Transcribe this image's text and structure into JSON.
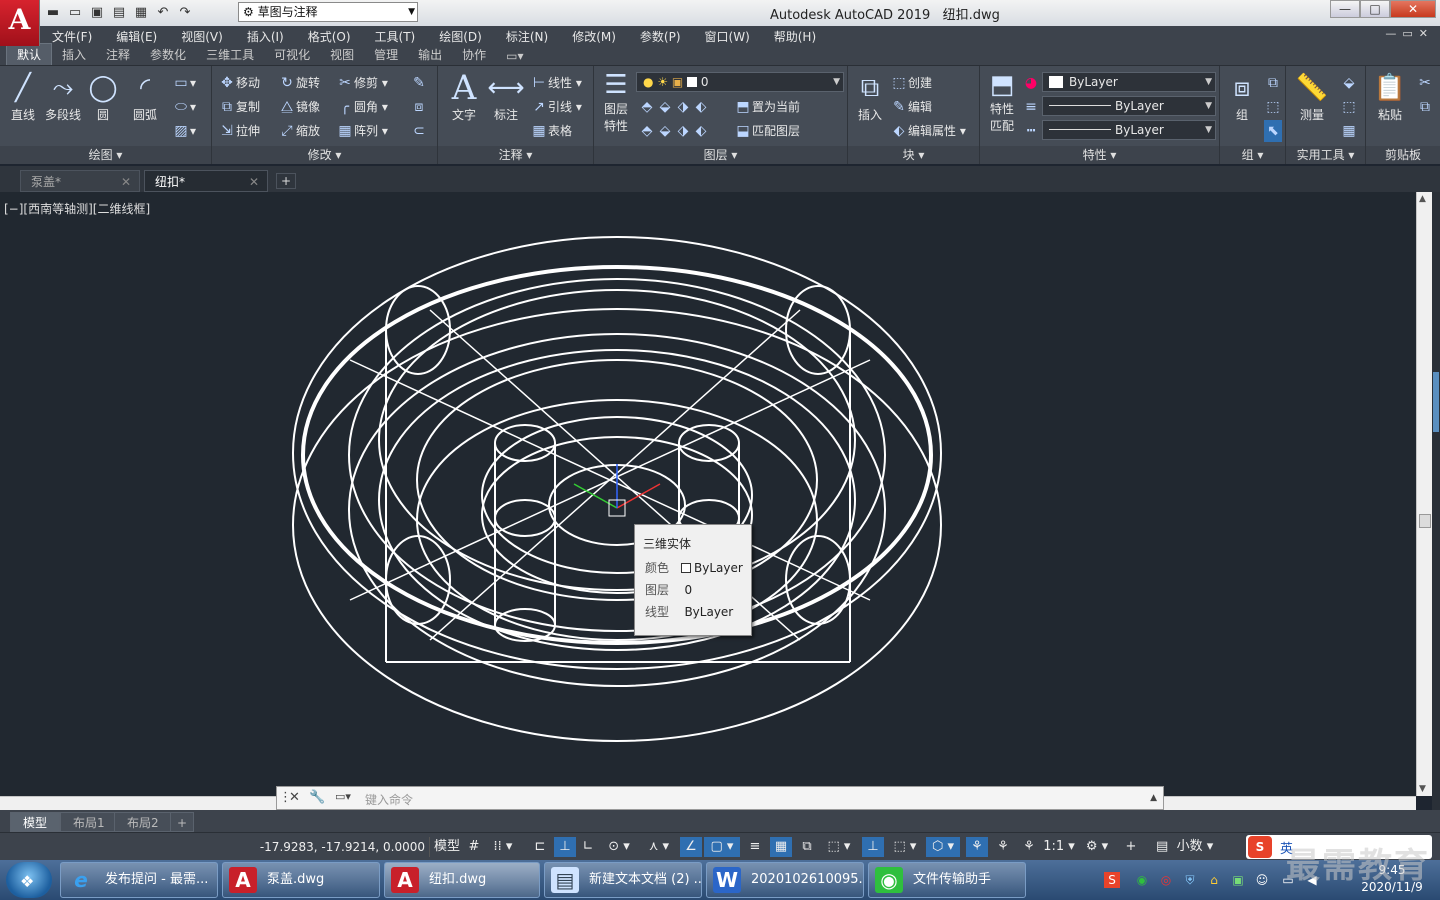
{
  "title_bar": {
    "app_logo": "A",
    "workspace": "草图与注释",
    "window_title": "Autodesk AutoCAD 2019",
    "file_title": "纽扣.dwg",
    "controls": [
      "—",
      "□",
      "✕"
    ]
  },
  "menu": [
    "文件(F)",
    "编辑(E)",
    "视图(V)",
    "插入(I)",
    "格式(O)",
    "工具(T)",
    "绘图(D)",
    "标注(N)",
    "修改(M)",
    "参数(P)",
    "窗口(W)",
    "帮助(H)"
  ],
  "ribbon_tabs": [
    "默认",
    "插入",
    "注释",
    "参数化",
    "三维工具",
    "可视化",
    "视图",
    "管理",
    "输出",
    "协作"
  ],
  "ribbon": {
    "draw": {
      "title": "绘图",
      "line": "直线",
      "polyline": "多段线",
      "circle": "圆",
      "arc": "圆弧"
    },
    "modify": {
      "title": "修改",
      "move": "移动",
      "rotate": "旋转",
      "trim": "修剪",
      "copy": "复制",
      "mirror": "镜像",
      "fillet": "圆角",
      "stretch": "拉伸",
      "scale": "缩放",
      "array": "阵列"
    },
    "annotation": {
      "title": "注释",
      "text": "文字",
      "dimension": "标注",
      "linear": "线性",
      "leader": "引线",
      "table": "表格"
    },
    "layers": {
      "title": "图层",
      "layer_props_1": "图层",
      "layer_props_2": "特性",
      "current_layer": "0",
      "set_current": "置为当前",
      "match_layer": "匹配图层"
    },
    "block": {
      "title": "块",
      "insert": "插入",
      "create": "创建",
      "edit": "编辑",
      "edit_attr": "编辑属性"
    },
    "properties": {
      "title": "特性",
      "match_1": "特性",
      "match_2": "匹配",
      "color": "ByLayer",
      "lineweight": "ByLayer",
      "linetype": "ByLayer"
    },
    "groups": {
      "title": "组",
      "group": "组"
    },
    "utilities": {
      "title": "实用工具",
      "measure": "测量"
    },
    "clipboard": {
      "title": "剪贴板",
      "paste": "粘贴"
    }
  },
  "file_tabs": [
    {
      "label": "泵盖*"
    },
    {
      "label": "纽扣*"
    }
  ],
  "viewport": {
    "label": "[−][西南等轴测][二维线框]"
  },
  "tooltip": {
    "title": "三维实体",
    "color_key": "颜色",
    "color_val": "ByLayer",
    "layer_key": "图层",
    "layer_val": "0",
    "linetype_key": "线型",
    "linetype_val": "ByLayer"
  },
  "command_line": {
    "placeholder": "键入命令"
  },
  "layout_tabs": [
    "模型",
    "布局1",
    "布局2"
  ],
  "status": {
    "coords": "-17.9283, -17.9214, 0.0000",
    "model": "模型",
    "scale": "1:1",
    "units": "小数"
  },
  "ime": {
    "lang": "英"
  },
  "taskbar": {
    "items": [
      {
        "label": "发布提问 - 最需..."
      },
      {
        "label": "泵盖.dwg"
      },
      {
        "label": "纽扣.dwg"
      },
      {
        "label": "新建文本文档 (2) ..."
      },
      {
        "label": "2020102610095..."
      },
      {
        "label": "文件传输助手"
      }
    ],
    "time": "9:45",
    "date": "2020/11/9"
  },
  "watermark": "最需教育",
  "colors": {
    "viewport_bg": "#212830",
    "ribbon_bg": "#454c56",
    "accent": "#2f6fb1",
    "autocad_red": "#c8202a"
  }
}
